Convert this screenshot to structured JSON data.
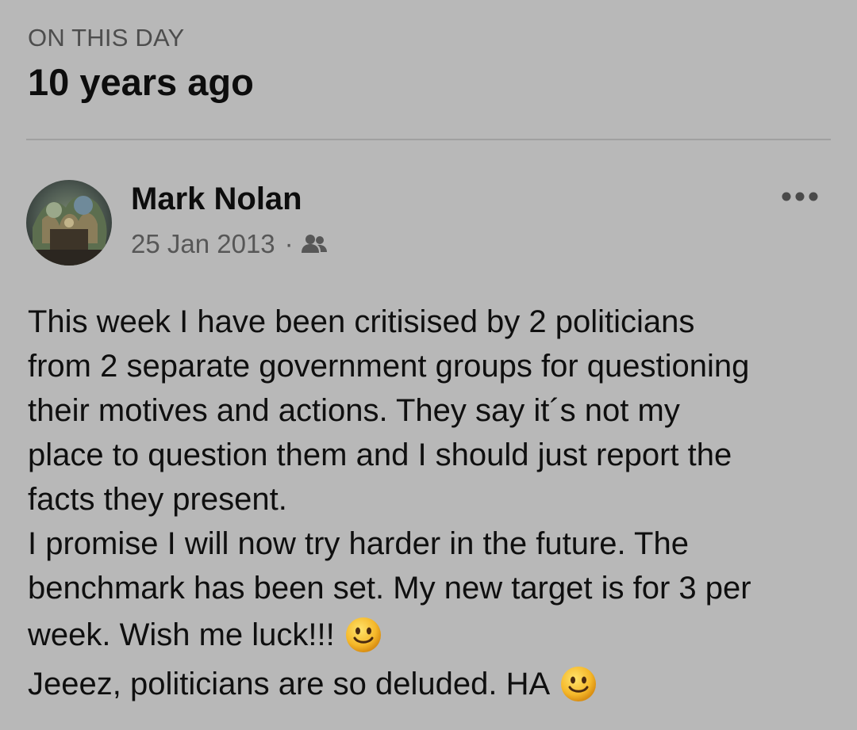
{
  "memories": {
    "label": "ON THIS DAY",
    "title": "10 years ago"
  },
  "post": {
    "author": "Mark Nolan",
    "date": "25 Jan 2013",
    "separator": "·",
    "audience_icon": "friends-icon",
    "more_icon": "more-options-icon",
    "body_lines": [
      "This week I have been critisised by 2 politicians",
      "from 2 separate government groups for questioning",
      "their motives and actions. They say it´s not my",
      "place to question them and I should just report the",
      "facts they present.",
      "I promise I will now try harder in the future. The",
      "benchmark has been set. My new target is for 3 per",
      "week. Wish me luck!!!",
      "Jeeez, politicians are so deluded. HA"
    ],
    "emoji_icon": "slightly-smiling-face-emoji"
  },
  "colors": {
    "background": "#b8b8b8",
    "text_primary": "#0d0d0d",
    "text_secondary": "#575757",
    "divider": "#a0a0a0"
  }
}
